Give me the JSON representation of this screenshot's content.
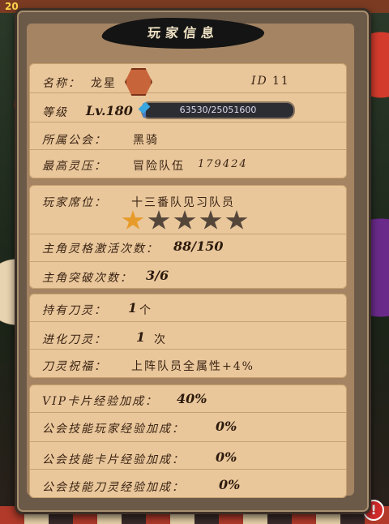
{
  "background": {
    "level_text": "20"
  },
  "title": "玩家信息",
  "basic": {
    "name_label": "名称：",
    "name_value": "龙星",
    "id_label": "ID",
    "id_value": "11",
    "level_label": "等级",
    "level_value": "Lv.180",
    "exp_text": "63530/25051600",
    "exp_fraction": 0.0025,
    "guild_label": "所属公会：",
    "guild_value": "黑骑",
    "pressure_label": "最高灵压：",
    "pressure_team": "冒险队伍",
    "pressure_value": "179424"
  },
  "rank": {
    "rank_label": "玩家席位：",
    "rank_value": "十三番队见习队员",
    "stars_filled": 1,
    "stars_total": 5,
    "activation_label": "主角灵格激活次数：",
    "activation_value": "88/150",
    "breakthrough_label": "主角突破次数：",
    "breakthrough_value": "3/6"
  },
  "blades": {
    "owned_label": "持有刀灵：",
    "owned_value": "1",
    "owned_unit": "个",
    "evolve_label": "进化刀灵：",
    "evolve_value": "1",
    "evolve_unit": "次",
    "blessing_label": "刀灵祝福：",
    "blessing_value": "上阵队员全属性+4%"
  },
  "bonus": {
    "vip_label": "VIP卡片经验加成：",
    "vip_value": "40%",
    "guild_player_label": "公会技能玩家经验加成：",
    "guild_player_value": "0%",
    "guild_card_label": "公会技能卡片经验加成：",
    "guild_card_value": "0%",
    "guild_blade_label": "公会技能刀灵经验加成：",
    "guild_blade_value": "0%"
  },
  "colors": {
    "panel": "#a48462",
    "section": "#e9c79b",
    "star_on": "#e79b2a",
    "star_off": "#55463a"
  }
}
